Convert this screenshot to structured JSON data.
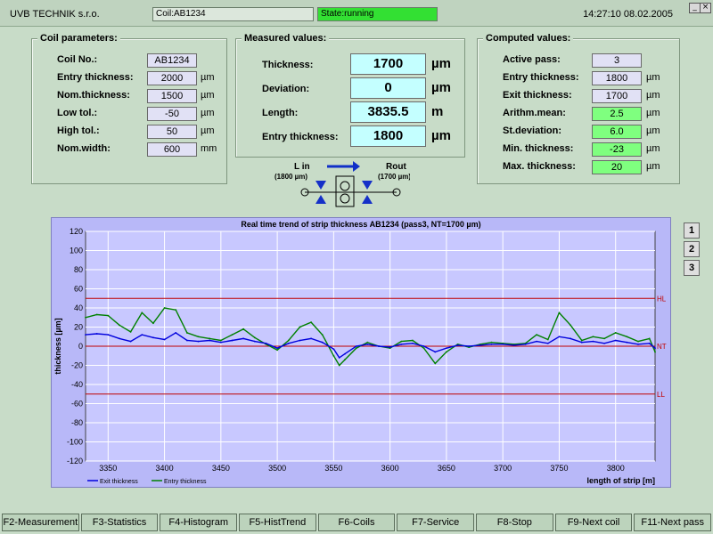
{
  "header": {
    "company": "UVB TECHNIK s.r.o.",
    "coil_field": "Coil:AB1234",
    "state_field": "State:running",
    "datetime": "14:27:10 08.02.2005",
    "min_symbol": "_",
    "close_symbol": "×"
  },
  "colors": {
    "background": "#c8dcc8",
    "state_ok": "#33e033",
    "chart_bg": "#b8b8f8",
    "exit_series": "#0000dd",
    "entry_series": "#008000",
    "limit_lines": "#c00000"
  },
  "coil_parameters": {
    "title": "Coil parameters:",
    "rows": [
      {
        "label": "Coil No.:",
        "value": "AB1234",
        "unit": ""
      },
      {
        "label": "Entry thickness:",
        "value": "2000",
        "unit": "µm"
      },
      {
        "label": "Nom.thickness:",
        "value": "1500",
        "unit": "µm"
      },
      {
        "label": "Low tol.:",
        "value": "-50",
        "unit": "µm"
      },
      {
        "label": "High tol.:",
        "value": "50",
        "unit": "µm"
      },
      {
        "label": "Nom.width:",
        "value": "600",
        "unit": "mm"
      }
    ]
  },
  "measured_values": {
    "title": "Measured values:",
    "rows": [
      {
        "label": "Thickness:",
        "value": "1700",
        "unit": "µm"
      },
      {
        "label": "Deviation:",
        "value": "0",
        "unit": "µm"
      },
      {
        "label": "Length:",
        "value": "3835.5",
        "unit": "m"
      },
      {
        "label": "Entry thickness:",
        "value": "1800",
        "unit": "µm"
      }
    ]
  },
  "computed_values": {
    "title": "Computed values:",
    "rows": [
      {
        "label": "Active pass:",
        "value": "3",
        "unit": "",
        "highlight": false
      },
      {
        "label": "Entry thickness:",
        "value": "1800",
        "unit": "µm",
        "highlight": false
      },
      {
        "label": "Exit thickness:",
        "value": "1700",
        "unit": "µm",
        "highlight": false
      },
      {
        "label": "Arithm.mean:",
        "value": "2.5",
        "unit": "µm",
        "highlight": true
      },
      {
        "label": "St.deviation:",
        "value": "6.0",
        "unit": "µm",
        "highlight": true
      },
      {
        "label": "Min. thickness:",
        "value": "-23",
        "unit": "µm",
        "highlight": true
      },
      {
        "label": "Max. thickness:",
        "value": "20",
        "unit": "µm",
        "highlight": true
      }
    ]
  },
  "mill": {
    "left_label": "L in",
    "left_value": "(1800 µm)",
    "right_label": "Rout",
    "right_value": "(1700 µm)"
  },
  "chart_data": {
    "type": "line",
    "title": "Real time trend of strip thickness  AB1234  (pass3, NT=1700 µm)",
    "xlabel": "length of strip [m]",
    "ylabel": "thickness [µm]",
    "xlim": [
      3330,
      3835
    ],
    "ylim": [
      -120,
      120
    ],
    "x_ticks": [
      3350,
      3400,
      3450,
      3500,
      3550,
      3600,
      3650,
      3700,
      3750,
      3800
    ],
    "y_ticks": [
      120,
      100,
      80,
      60,
      40,
      20,
      0,
      -20,
      -40,
      -60,
      -80,
      -100,
      -120
    ],
    "grid": true,
    "legend_position": "bottom-left",
    "reference_lines": [
      {
        "name": "HL",
        "y": 50
      },
      {
        "name": "NT",
        "y": 0
      },
      {
        "name": "LL",
        "y": -50
      }
    ],
    "series": [
      {
        "name": "Exit thickness",
        "x": [
          3330,
          3340,
          3350,
          3360,
          3370,
          3380,
          3390,
          3400,
          3410,
          3420,
          3430,
          3440,
          3450,
          3460,
          3470,
          3480,
          3490,
          3500,
          3510,
          3520,
          3530,
          3540,
          3550,
          3555,
          3560,
          3570,
          3580,
          3590,
          3600,
          3610,
          3620,
          3630,
          3640,
          3650,
          3660,
          3670,
          3680,
          3690,
          3700,
          3710,
          3720,
          3730,
          3740,
          3750,
          3760,
          3770,
          3780,
          3790,
          3800,
          3810,
          3820,
          3830,
          3835
        ],
        "y": [
          12,
          13,
          12,
          8,
          5,
          12,
          9,
          7,
          14,
          6,
          5,
          6,
          4,
          6,
          8,
          5,
          3,
          -2,
          3,
          6,
          8,
          4,
          -3,
          -12,
          -8,
          0,
          2,
          0,
          -1,
          2,
          3,
          0,
          -6,
          -2,
          1,
          0,
          1,
          2,
          2,
          1,
          2,
          5,
          3,
          10,
          8,
          4,
          5,
          3,
          6,
          4,
          2,
          3,
          -2
        ]
      },
      {
        "name": "Entry thickness",
        "x": [
          3330,
          3340,
          3350,
          3360,
          3370,
          3380,
          3390,
          3400,
          3410,
          3420,
          3430,
          3440,
          3450,
          3460,
          3470,
          3480,
          3490,
          3500,
          3510,
          3520,
          3530,
          3540,
          3550,
          3555,
          3560,
          3570,
          3580,
          3590,
          3600,
          3610,
          3620,
          3630,
          3640,
          3650,
          3660,
          3670,
          3680,
          3690,
          3700,
          3710,
          3720,
          3730,
          3740,
          3750,
          3760,
          3770,
          3780,
          3790,
          3800,
          3810,
          3820,
          3830,
          3835
        ],
        "y": [
          30,
          33,
          32,
          22,
          15,
          35,
          24,
          40,
          38,
          14,
          10,
          8,
          6,
          12,
          18,
          9,
          2,
          -4,
          6,
          20,
          25,
          12,
          -10,
          -20,
          -14,
          -2,
          4,
          0,
          -2,
          5,
          6,
          -2,
          -18,
          -6,
          2,
          -1,
          2,
          4,
          3,
          2,
          3,
          12,
          7,
          35,
          22,
          6,
          10,
          8,
          14,
          10,
          5,
          8,
          -6
        ]
      }
    ]
  },
  "side_buttons": [
    "1",
    "2",
    "3"
  ],
  "function_keys": [
    "F2-Measurement",
    "F3-Statistics",
    "F4-Histogram",
    "F5-HistTrend",
    "F6-Coils",
    "F7-Service",
    "F8-Stop",
    "F9-Next coil",
    "F11-Next pass"
  ]
}
